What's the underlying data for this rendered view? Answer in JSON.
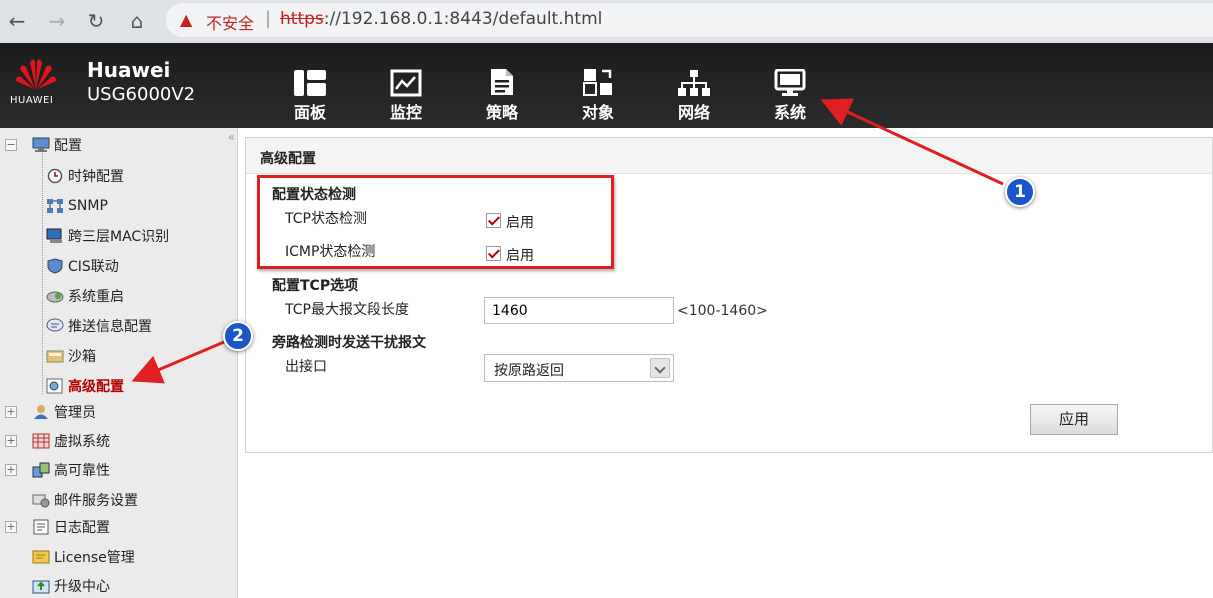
{
  "browser": {
    "back": "←",
    "forward": "→",
    "reload": "↻",
    "home": "⌂",
    "security_icon": "▲",
    "security_label": "不安全",
    "url_scheme": "https",
    "url_rest": "://192.168.0.1:8443/default.html"
  },
  "header": {
    "logo_text": "HUAWEI",
    "brand": "Huawei",
    "model": "USG6000V2",
    "menu": [
      {
        "label": "面板",
        "icon": "dashboard-icon"
      },
      {
        "label": "监控",
        "icon": "monitor-chart-icon"
      },
      {
        "label": "策略",
        "icon": "document-icon"
      },
      {
        "label": "对象",
        "icon": "objects-icon"
      },
      {
        "label": "网络",
        "icon": "network-icon"
      },
      {
        "label": "系统",
        "icon": "computer-icon"
      }
    ]
  },
  "sidebar": {
    "collapse": "«",
    "items": [
      {
        "label": "配置",
        "expander": "−"
      },
      {
        "label": "时钟配置"
      },
      {
        "label": "SNMP"
      },
      {
        "label": "跨三层MAC识别"
      },
      {
        "label": "CIS联动"
      },
      {
        "label": "系统重启"
      },
      {
        "label": "推送信息配置"
      },
      {
        "label": "沙箱"
      },
      {
        "label": "高级配置"
      },
      {
        "label": "管理员",
        "expander": "+"
      },
      {
        "label": "虚拟系统",
        "expander": "+"
      },
      {
        "label": "高可靠性",
        "expander": "+"
      },
      {
        "label": "邮件服务设置"
      },
      {
        "label": "日志配置",
        "expander": "+"
      },
      {
        "label": "License管理"
      },
      {
        "label": "升级中心"
      }
    ]
  },
  "panel": {
    "title": "高级配置",
    "section_state": "配置状态检测",
    "tcp_label": "TCP状态检测",
    "icmp_label": "ICMP状态检测",
    "enable_label": "启用",
    "section_tcp": "配置TCP选项",
    "mss_label": "TCP最大报文段长度",
    "mss_value": "1460",
    "mss_hint": "<100-1460>",
    "section_bypass": "旁路检测时发送干扰报文",
    "egress_label": "出接口",
    "egress_value": "按原路返回",
    "apply_label": "应用"
  },
  "annotations": {
    "badge1": "1",
    "badge2": "2"
  },
  "colors": {
    "header_bg": "#222222",
    "active_item": "#b40000",
    "annotation_red": "#e02020",
    "badge_blue": "#1a56c8"
  }
}
